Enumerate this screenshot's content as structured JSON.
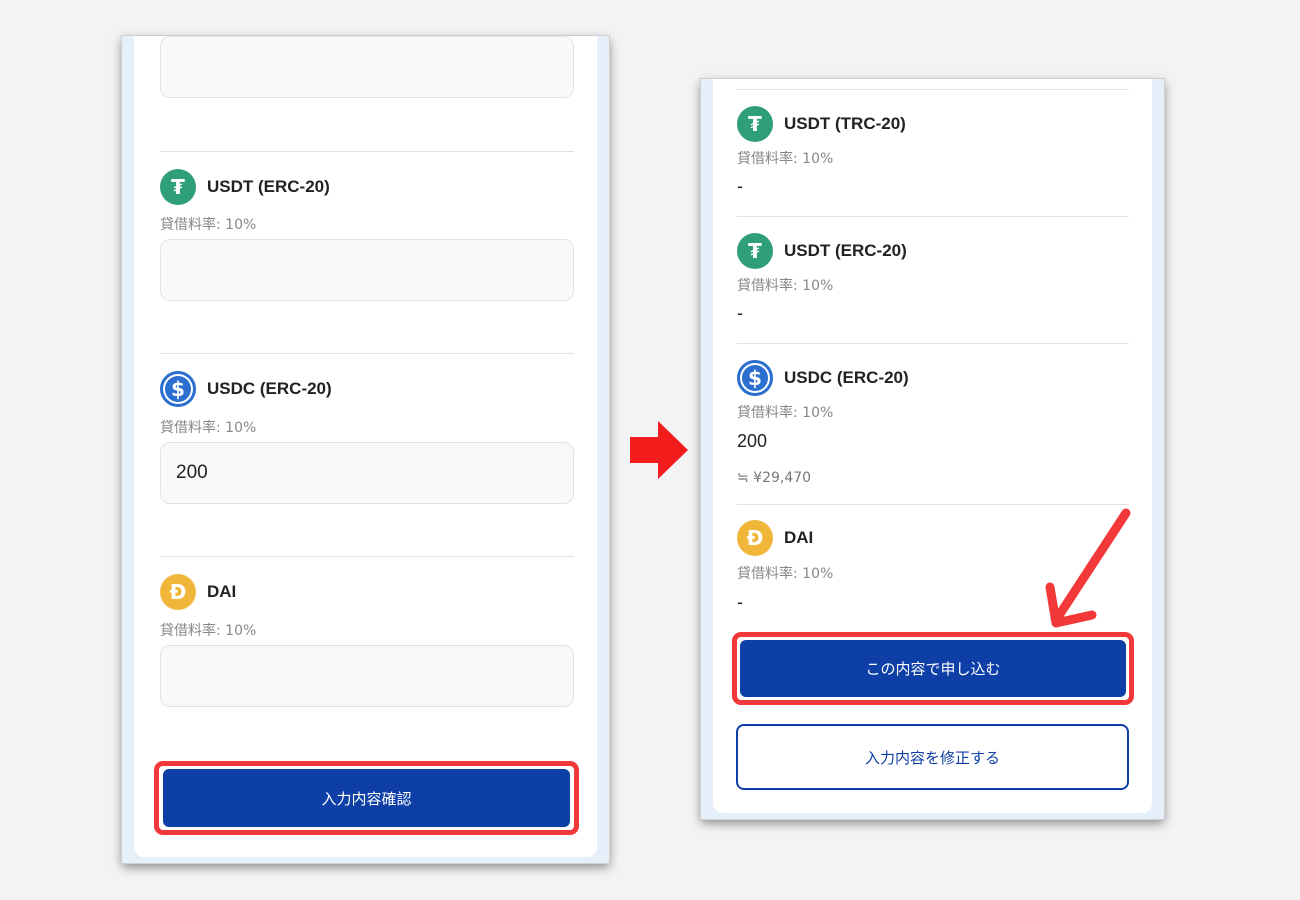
{
  "left": {
    "assets": [
      {
        "name": "USDT (ERC-20)",
        "rate": "貸借料率: 10%",
        "value": "",
        "icon": "tether-icon"
      },
      {
        "name": "USDC (ERC-20)",
        "rate": "貸借料率: 10%",
        "value": "200",
        "icon": "usdc-icon"
      },
      {
        "name": "DAI",
        "rate": "貸借料率: 10%",
        "value": "",
        "icon": "dai-icon"
      }
    ],
    "confirm_button": "入力内容確認"
  },
  "right": {
    "assets": [
      {
        "name": "USDT (TRC-20)",
        "rate": "貸借料率: 10%",
        "value": "-",
        "icon": "tether-icon"
      },
      {
        "name": "USDT (ERC-20)",
        "rate": "貸借料率: 10%",
        "value": "-",
        "icon": "tether-icon"
      },
      {
        "name": "USDC (ERC-20)",
        "rate": "貸借料率: 10%",
        "value": "200",
        "approx": "≒ ¥29,470",
        "icon": "usdc-icon"
      },
      {
        "name": "DAI",
        "rate": "貸借料率: 10%",
        "value": "-",
        "icon": "dai-icon"
      }
    ],
    "apply_button": "この内容で申し込む",
    "edit_button": "入力内容を修正する"
  },
  "colors": {
    "primary_blue": "#0e3fa6",
    "highlight_red": "#f23838",
    "tether_green": "#2f9f78",
    "usdc_blue": "#2b6fd1",
    "dai_yellow": "#f0b63a"
  }
}
